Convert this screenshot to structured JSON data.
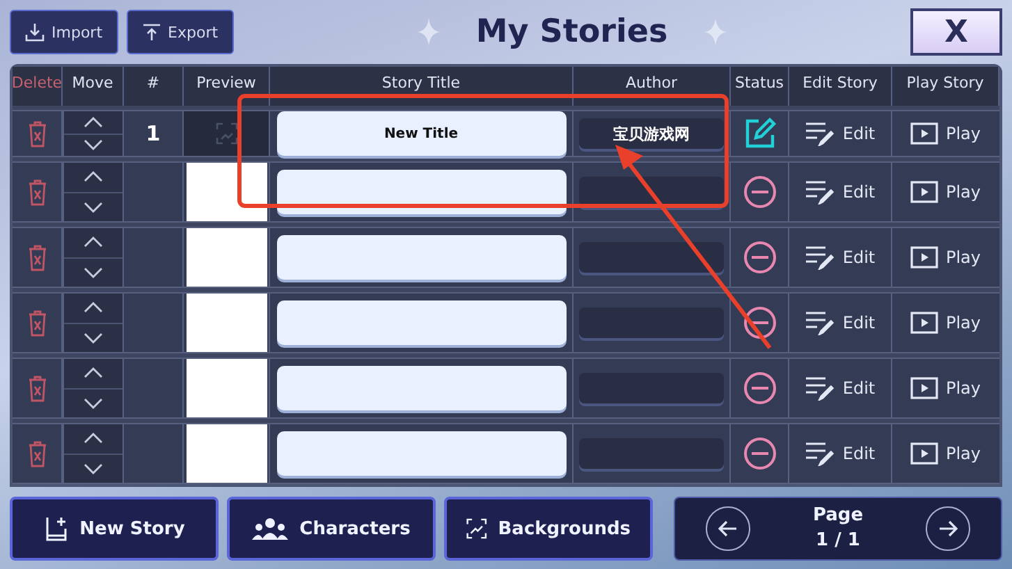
{
  "toolbar": {
    "import": "Import",
    "export": "Export"
  },
  "title": "My Stories",
  "close": "X",
  "columns": [
    "Delete",
    "Move",
    "#",
    "Preview",
    "Story Title",
    "Author",
    "Status",
    "Edit Story",
    "Play Story"
  ],
  "rows": [
    {
      "number": "1",
      "preview": {
        "kind": "icon"
      },
      "title": "New Title",
      "author": "宝贝游戏网",
      "status": {
        "kind": "editable"
      },
      "edit": "Edit",
      "play": "Play"
    },
    {
      "number": "",
      "preview": {
        "kind": "blank"
      },
      "title": "",
      "author": "",
      "status": {
        "kind": "empty"
      },
      "edit": "Edit",
      "play": "Play"
    },
    {
      "number": "",
      "preview": {
        "kind": "blank"
      },
      "title": "",
      "author": "",
      "status": {
        "kind": "empty"
      },
      "edit": "Edit",
      "play": "Play"
    },
    {
      "number": "",
      "preview": {
        "kind": "blank"
      },
      "title": "",
      "author": "",
      "status": {
        "kind": "empty"
      },
      "edit": "Edit",
      "play": "Play"
    },
    {
      "number": "",
      "preview": {
        "kind": "blank"
      },
      "title": "",
      "author": "",
      "status": {
        "kind": "empty"
      },
      "edit": "Edit",
      "play": "Play"
    },
    {
      "number": "",
      "preview": {
        "kind": "blank"
      },
      "title": "",
      "author": "",
      "status": {
        "kind": "empty"
      },
      "edit": "Edit",
      "play": "Play"
    }
  ],
  "bottom": {
    "new_story": "New Story",
    "characters": "Characters",
    "backgrounds": "Backgrounds"
  },
  "pager": {
    "label": "Page",
    "value": "1 / 1"
  }
}
